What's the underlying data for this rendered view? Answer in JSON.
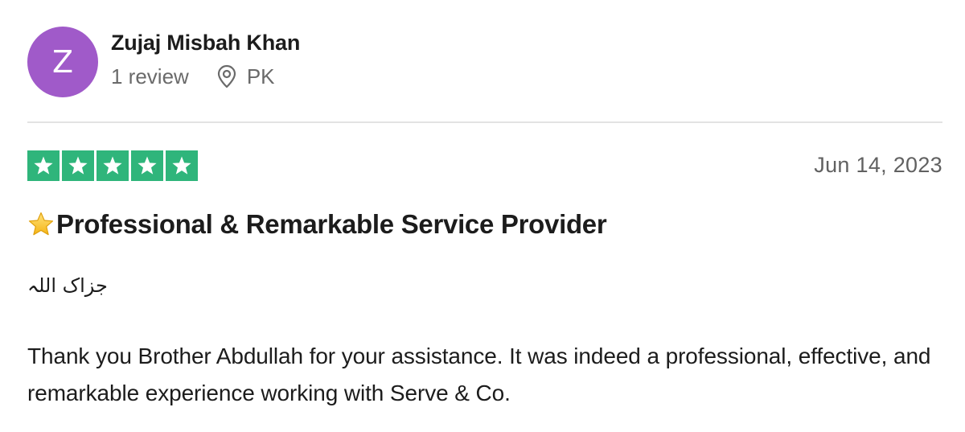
{
  "reviewer": {
    "avatar_initial": "Z",
    "avatar_color": "#a05ac9",
    "name": "Zujaj Misbah Khan",
    "review_count": "1 review",
    "location_icon": "location-pin-icon",
    "country": "PK"
  },
  "review": {
    "rating": 5,
    "rating_max": 5,
    "star_color": "#2fb57b",
    "date": "Jun 14, 2023",
    "title_icon": "star-emoji-icon",
    "title": "Professional & Remarkable Service Provider",
    "arabic_line": "جزاک اللہ",
    "body": "Thank you Brother Abdullah for your assistance. It was indeed a professional, effective, and remarkable experience working with Serve & Co."
  }
}
